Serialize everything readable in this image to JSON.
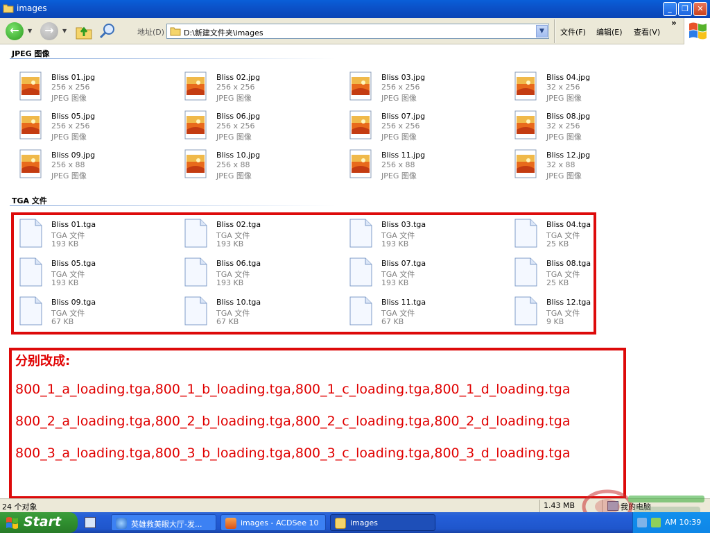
{
  "window": {
    "title": "images"
  },
  "toolbar": {
    "back_icon": "back-arrow-icon",
    "forward_icon": "forward-arrow-icon",
    "up_icon": "folder-up-icon",
    "search_icon": "search-icon",
    "address_label": "地址(D)",
    "address_value": "D:\\新建文件夹\\images",
    "menu": [
      "文件(F)",
      "编辑(E)",
      "查看(V)"
    ],
    "chevron": "»"
  },
  "groups": {
    "jpeg": {
      "header": "JPEG 图像",
      "items": [
        {
          "name": "Bliss 01.jpg",
          "line2": "256 x 256",
          "line3": "JPEG 图像"
        },
        {
          "name": "Bliss 02.jpg",
          "line2": "256 x 256",
          "line3": "JPEG 图像"
        },
        {
          "name": "Bliss 03.jpg",
          "line2": "256 x 256",
          "line3": "JPEG 图像"
        },
        {
          "name": "Bliss 04.jpg",
          "line2": "32 x 256",
          "line3": "JPEG 图像"
        },
        {
          "name": "Bliss 05.jpg",
          "line2": "256 x 256",
          "line3": "JPEG 图像"
        },
        {
          "name": "Bliss 06.jpg",
          "line2": "256 x 256",
          "line3": "JPEG 图像"
        },
        {
          "name": "Bliss 07.jpg",
          "line2": "256 x 256",
          "line3": "JPEG 图像"
        },
        {
          "name": "Bliss 08.jpg",
          "line2": "32 x 256",
          "line3": "JPEG 图像"
        },
        {
          "name": "Bliss 09.jpg",
          "line2": "256 x 88",
          "line3": "JPEG 图像"
        },
        {
          "name": "Bliss 10.jpg",
          "line2": "256 x 88",
          "line3": "JPEG 图像"
        },
        {
          "name": "Bliss 11.jpg",
          "line2": "256 x 88",
          "line3": "JPEG 图像"
        },
        {
          "name": "Bliss 12.jpg",
          "line2": "32 x 88",
          "line3": "JPEG 图像"
        }
      ]
    },
    "tga": {
      "header": "TGA 文件",
      "items": [
        {
          "name": "Bliss 01.tga",
          "line2": "TGA 文件",
          "line3": "193 KB"
        },
        {
          "name": "Bliss 02.tga",
          "line2": "TGA 文件",
          "line3": "193 KB"
        },
        {
          "name": "Bliss 03.tga",
          "line2": "TGA 文件",
          "line3": "193 KB"
        },
        {
          "name": "Bliss 04.tga",
          "line2": "TGA 文件",
          "line3": "25 KB"
        },
        {
          "name": "Bliss 05.tga",
          "line2": "TGA 文件",
          "line3": "193 KB"
        },
        {
          "name": "Bliss 06.tga",
          "line2": "TGA 文件",
          "line3": "193 KB"
        },
        {
          "name": "Bliss 07.tga",
          "line2": "TGA 文件",
          "line3": "193 KB"
        },
        {
          "name": "Bliss 08.tga",
          "line2": "TGA 文件",
          "line3": "25 KB"
        },
        {
          "name": "Bliss 09.tga",
          "line2": "TGA 文件",
          "line3": "67 KB"
        },
        {
          "name": "Bliss 10.tga",
          "line2": "TGA 文件",
          "line3": "67 KB"
        },
        {
          "name": "Bliss 11.tga",
          "line2": "TGA 文件",
          "line3": "67 KB"
        },
        {
          "name": "Bliss 12.tga",
          "line2": "TGA 文件",
          "line3": "9 KB"
        }
      ]
    }
  },
  "annotation": {
    "title": "分别改成:",
    "lines": [
      "800_1_a_loading.tga,800_1_b_loading.tga,800_1_c_loading.tga,800_1_d_loading.tga",
      "800_2_a_loading.tga,800_2_b_loading.tga,800_2_c_loading.tga,800_2_d_loading.tga",
      "800_3_a_loading.tga,800_3_b_loading.tga,800_3_c_loading.tga,800_3_d_loading.tga"
    ],
    "color": "#e00000"
  },
  "statusbar": {
    "count": "24 个对象",
    "size": "1.43 MB",
    "location": "我的电脑"
  },
  "taskbar": {
    "start_label": "Start",
    "tasks": [
      {
        "label": "英雄救美眼大厅-发...",
        "icon": "ie-icon"
      },
      {
        "label": "images - ACDSee 10",
        "icon": "acdsee-icon"
      },
      {
        "label": "images",
        "icon": "folder-icon"
      }
    ],
    "clock": "AM 10:39"
  }
}
